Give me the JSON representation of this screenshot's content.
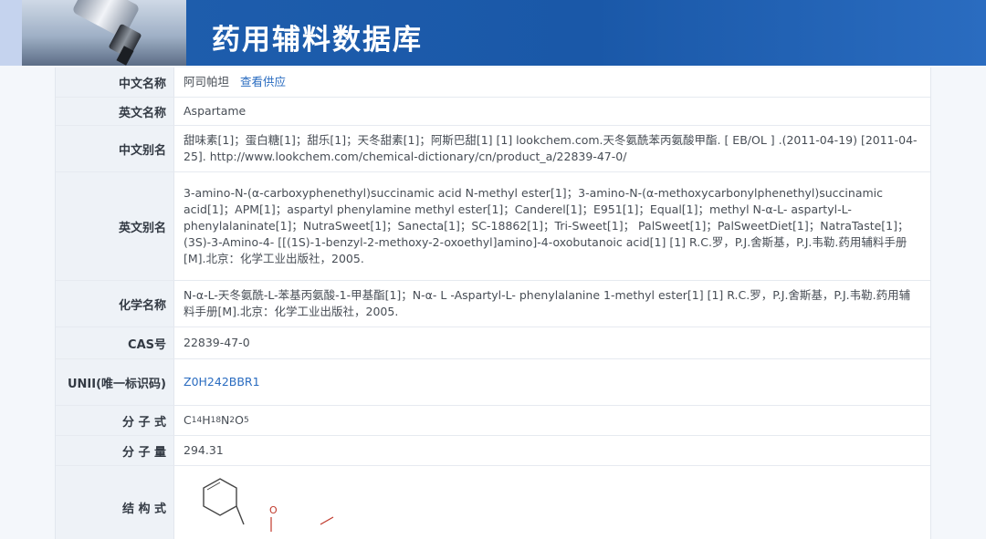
{
  "banner": {
    "title": "药用辅料数据库"
  },
  "rows": {
    "chinese_name": {
      "label": "中文名称",
      "value": "阿司帕坦",
      "link": "查看供应"
    },
    "english_name": {
      "label": "英文名称",
      "value": "Aspartame"
    },
    "chinese_alias": {
      "label": "中文别名",
      "value": "甜味素[1]；蛋白糖[1]；甜乐[1]；天冬甜素[1]；阿斯巴甜[1] [1] lookchem.com.天冬氨酰苯丙氨酸甲酯. [ EB/OL ] .(2011-04-19) [2011-04-25]. http://www.lookchem.com/chemical-dictionary/cn/product_a/22839-47-0/"
    },
    "english_alias": {
      "label": "英文别名",
      "value": "3-amino-N-(α-carboxyphenethyl)succinamic acid N-methyl ester[1]；3-amino-N-(α-methoxycarbonylphenethyl)succinamic acid[1]；APM[1]；aspartyl phenylamine methyl ester[1]；Canderel[1]；E951[1]；Equal[1]；methyl N-α-L- aspartyl-L-phenylalaninate[1]；NutraSweet[1]；Sanecta[1]；SC-18862[1]；Tri-Sweet[1]； PalSweet[1]；PalSweetDiet[1]；NatraTaste[1]；(3S)-3-Amino-4- [[(1S)-1-benzyl-2-methoxy-2-oxoethyl]amino]-4-oxobutanoic acid[1] [1] R.C.罗，P.J.舍斯基，P.J.韦勒.药用辅料手册[M].北京：化学工业出版社，2005."
    },
    "chemical_name": {
      "label": "化学名称",
      "value": "N-α-L-天冬氨酰-L-苯基丙氨酸-1-甲基酯[1]；N-α- L -Aspartyl-L- phenylalanine 1-methyl ester[1] [1] R.C.罗，P.J.舍斯基，P.J.韦勒.药用辅料手册[M].北京：化学工业出版社，2005."
    },
    "cas": {
      "label": "CAS号",
      "value": "22839-47-0"
    },
    "unii": {
      "label": "UNII(唯一标识码)",
      "value": "Z0H242BBR1"
    },
    "formula": {
      "label": "分 子 式",
      "c": "C",
      "c_n": "14",
      "h": "H",
      "h_n": "18",
      "n": "N",
      "n_n": "2",
      "o": "O",
      "o_n": "5"
    },
    "mw": {
      "label": "分 子 量",
      "value": "294.31"
    },
    "structure": {
      "label": "结 构 式",
      "oxygen_symbol": "O"
    }
  }
}
